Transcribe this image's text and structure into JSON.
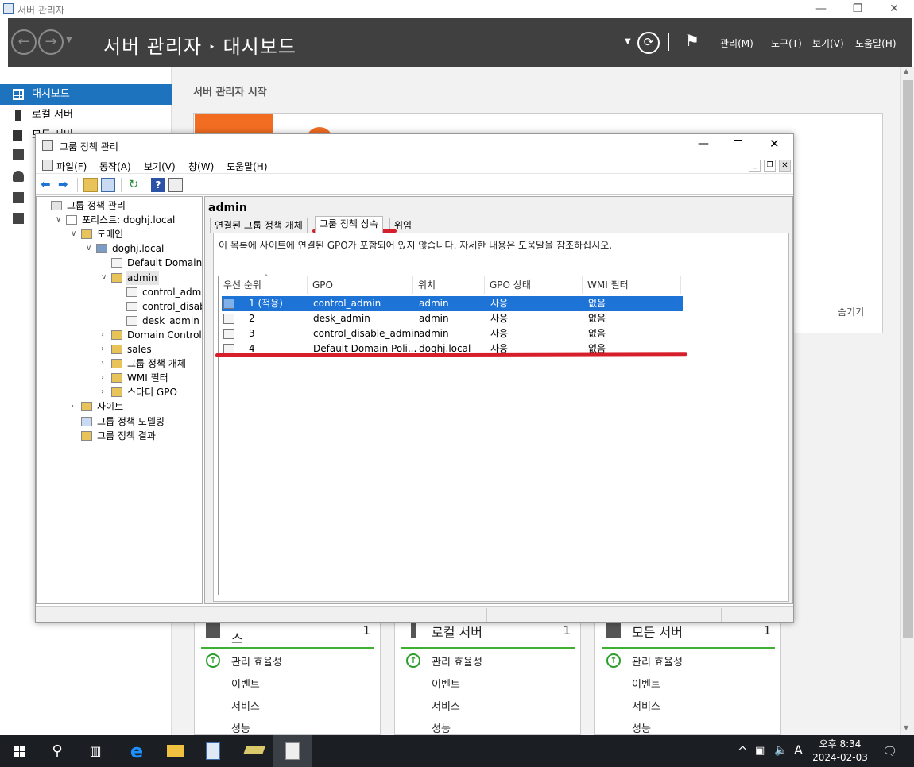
{
  "server_manager": {
    "window_title": "서버 관리자",
    "breadcrumb_root": "서버 관리자",
    "breadcrumb_sep": "‣",
    "breadcrumb_page": "대시보드",
    "header_menus": [
      "관리(M)",
      "도구(T)",
      "보기(V)",
      "도움말(H)"
    ],
    "sidebar": [
      {
        "label": "대시보드",
        "icon": "dashboard-icon",
        "active": true
      },
      {
        "label": "로컬 서버",
        "icon": "server-icon",
        "active": false
      },
      {
        "label": "모든 서버",
        "icon": "servers-icon",
        "active": false
      }
    ],
    "start_heading": "서버 관리자 시작",
    "hide_label": "숨기기",
    "tiles": [
      {
        "title": "역할 및 기능 그룹 서비스",
        "title_visible": "스",
        "count": "1",
        "rows": [
          "관리 효율성",
          "이벤트",
          "서비스",
          "성능"
        ]
      },
      {
        "title": "로컬 서버",
        "title_visible": "로컬 서버",
        "count": "1",
        "rows": [
          "관리 효율성",
          "이벤트",
          "서비스",
          "성능"
        ]
      },
      {
        "title": "모든 서버",
        "title_visible": "모든 서버",
        "count": "1",
        "rows": [
          "관리 효율성",
          "이벤트",
          "서비스",
          "성능"
        ]
      }
    ]
  },
  "gpmc": {
    "window_title": "그룹 정책 관리",
    "menus": [
      "파일(F)",
      "동작(A)",
      "보기(V)",
      "창(W)",
      "도움말(H)"
    ],
    "tree": [
      {
        "label": "그룹 정책 관리",
        "depth": 0,
        "exp": "",
        "icon": "gpmc-icon"
      },
      {
        "label": "포리스트: doghj.local",
        "depth": 1,
        "exp": "∨",
        "icon": "forest-icon"
      },
      {
        "label": "도메인",
        "depth": 2,
        "exp": "∨",
        "icon": "domains-folder-icon"
      },
      {
        "label": "doghj.local",
        "depth": 3,
        "exp": "∨",
        "icon": "domain-icon"
      },
      {
        "label": "Default Domain Po",
        "depth": 4,
        "exp": "",
        "icon": "gpo-link-icon"
      },
      {
        "label": "admin",
        "depth": 4,
        "exp": "∨",
        "icon": "ou-folder-icon",
        "selected": true
      },
      {
        "label": "control_admin",
        "depth": 5,
        "exp": "",
        "icon": "gpo-link-icon"
      },
      {
        "label": "control_disable_",
        "depth": 5,
        "exp": "",
        "icon": "gpo-link-icon"
      },
      {
        "label": "desk_admin",
        "depth": 5,
        "exp": "",
        "icon": "gpo-link-icon"
      },
      {
        "label": "Domain Controllers",
        "depth": 4,
        "exp": "›",
        "icon": "ou-folder-icon"
      },
      {
        "label": "sales",
        "depth": 4,
        "exp": "›",
        "icon": "ou-folder-icon"
      },
      {
        "label": "그룹 정책 개체",
        "depth": 4,
        "exp": "›",
        "icon": "gpo-folder-icon"
      },
      {
        "label": "WMI 필터",
        "depth": 4,
        "exp": "›",
        "icon": "wmi-folder-icon"
      },
      {
        "label": "스타터 GPO",
        "depth": 4,
        "exp": "›",
        "icon": "starter-folder-icon"
      },
      {
        "label": "사이트",
        "depth": 2,
        "exp": "›",
        "icon": "sites-folder-icon"
      },
      {
        "label": "그룹 정책 모델링",
        "depth": 2,
        "exp": "",
        "icon": "modeling-icon"
      },
      {
        "label": "그룹 정책 결과",
        "depth": 2,
        "exp": "",
        "icon": "results-icon"
      }
    ],
    "right_title": "admin",
    "tabs": [
      {
        "label": "연결된 그룹 정책 개체",
        "selected": false
      },
      {
        "label": "그룹 정책 상속",
        "selected": true
      },
      {
        "label": "위임",
        "selected": false
      }
    ],
    "info": "이 목록에 사이트에 연결된 GPO가 포함되어 있지 않습니다. 자세한 내용은 도움말을 참조하십시오.",
    "columns": [
      "우선 순위",
      "GPO",
      "위치",
      "GPO 상태",
      "WMI 필터"
    ],
    "rows": [
      {
        "priority": "1  (적용)",
        "gpo": "control_admin",
        "location": "admin",
        "status": "사용",
        "wmi": "없음",
        "selected": true
      },
      {
        "priority": "2",
        "gpo": "desk_admin",
        "location": "admin",
        "status": "사용",
        "wmi": "없음",
        "selected": false
      },
      {
        "priority": "3",
        "gpo": "control_disable_admin",
        "location": "admin",
        "status": "사용",
        "wmi": "없음",
        "selected": false
      },
      {
        "priority": "4",
        "gpo": "Default Domain Poli...",
        "location": "doghj.local",
        "status": "사용",
        "wmi": "없음",
        "selected": false
      }
    ]
  },
  "taskbar": {
    "time": "오후 8:34",
    "date": "2024-02-03",
    "ime": "A"
  },
  "colors": {
    "accent": "#1e73be",
    "header_bg": "#404040",
    "orange": "#f26d21",
    "green": "#3db030",
    "annotation_red": "#d71f2b"
  }
}
